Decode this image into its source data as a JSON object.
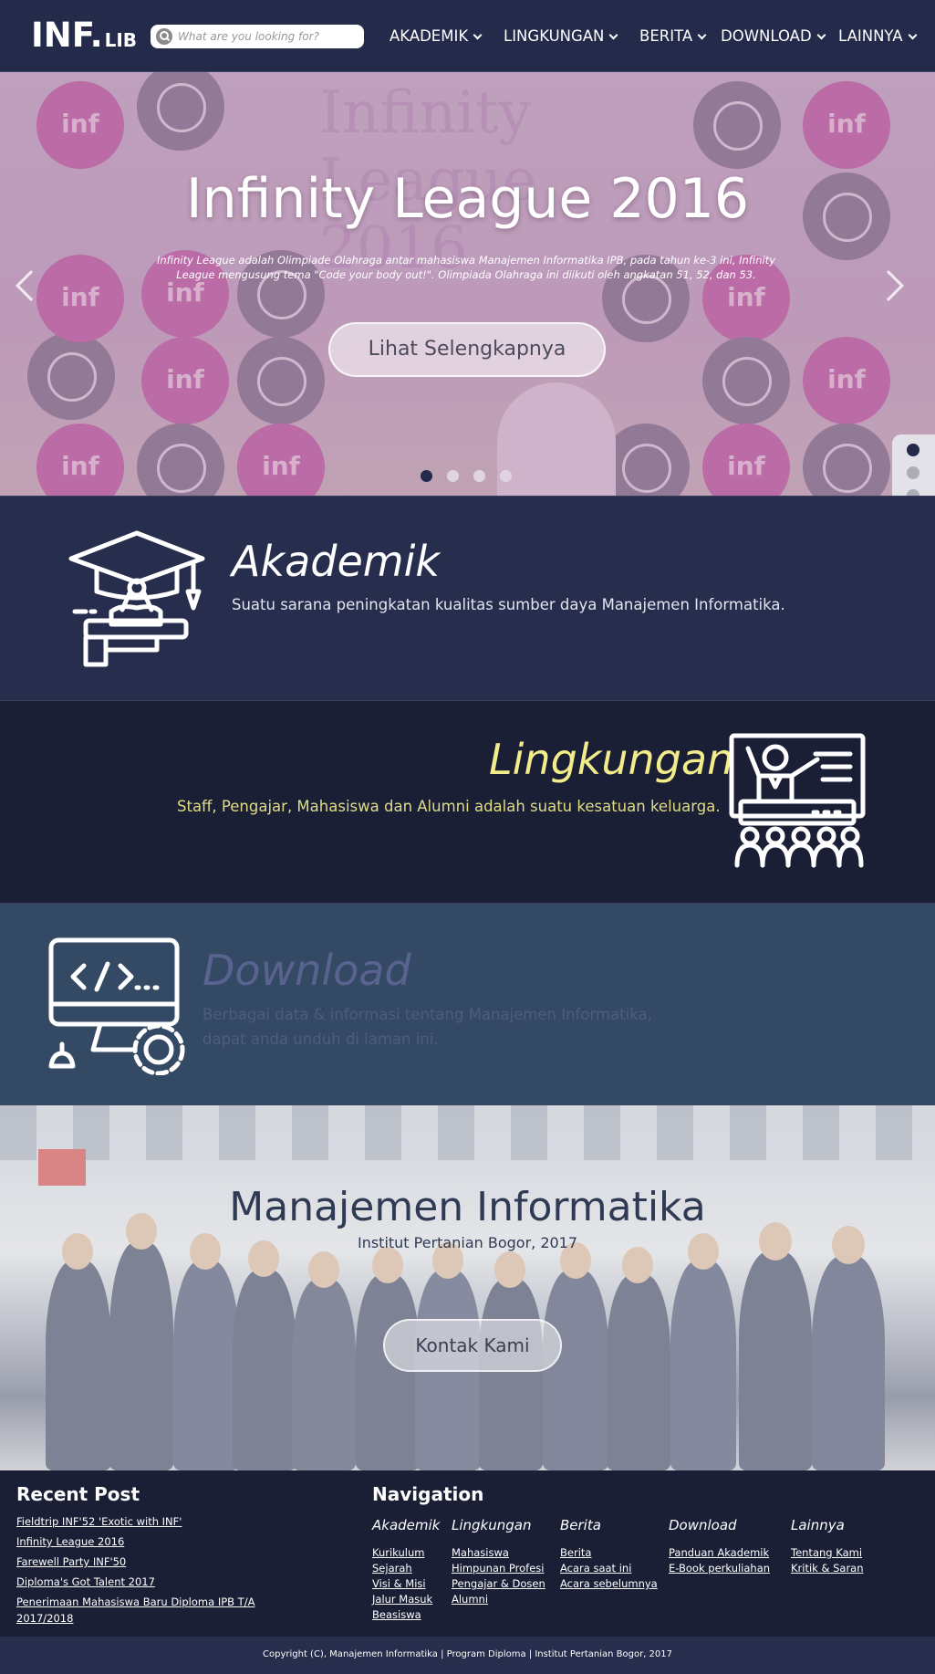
{
  "navbar": {
    "logo_main": "INF.",
    "logo_suffix": "LIB",
    "search_placeholder": "What are you looking for?",
    "menu": [
      "AKADEMIK",
      "LINGKUNGAN",
      "BERITA",
      "DOWNLOAD",
      "LAINNYA"
    ]
  },
  "hero": {
    "banner_title": "Infinity League 2016",
    "title": "Infinity League 2016",
    "description": "Infinity League adalah Olimpiade Olahraga antar mahasiswa Manajemen Informatika IPB, pada tahun ke-3 ini, Infinity League mengusung tema \"Code your body out!\". Olimpiada Olahraga ini diikuti oleh angkatan 51, 52, dan 53.",
    "button": "Lihat Selengkapnya",
    "slide_count": 4,
    "active_slide": 1
  },
  "side_nav": {
    "count": 5,
    "active": 1
  },
  "sections": {
    "akademik": {
      "title": "Akademik",
      "description": "Suatu sarana peningkatan kualitas sumber daya Manajemen Informatika.",
      "icon": "graduation-cap-icon",
      "title_color": "#ffffff"
    },
    "lingkungan": {
      "title": "Lingkungan",
      "description": "Staff, Pengajar, Mahasiswa dan Alumni adalah suatu kesatuan keluarga.",
      "icon": "teacher-audience-icon",
      "title_color": "#f2ed8a"
    },
    "download": {
      "title": "Download",
      "description_line1": "Berbagai data & informasi tentang Manajemen Informatika,",
      "description_line2": "dapat anda unduh di laman ini.",
      "icon": "computer-code-icon",
      "title_color": "#5a6390"
    }
  },
  "photo_banner": {
    "title": "Manajemen Informatika",
    "subtitle": "Institut Pertanian Bogor, 2017",
    "button": "Kontak Kami"
  },
  "footer": {
    "recent_post_heading": "Recent Post",
    "recent_posts": [
      "Fieldtrip INF'52 'Exotic with INF'",
      "Infinity League 2016",
      "Farewell Party INF'50",
      "Diploma's Got Talent 2017",
      "Penerimaan Mahasiswa Baru Diploma IPB T/A",
      "2017/2018"
    ],
    "navigation_heading": "Navigation",
    "columns": [
      {
        "heading": "Akademik",
        "links": [
          "Kurikulum",
          "Sejarah",
          "Visi & Misi",
          "Jalur Masuk",
          "Beasiswa"
        ]
      },
      {
        "heading": "Lingkungan",
        "links": [
          "Mahasiswa",
          "Himpunan Profesi",
          "Pengajar & Dosen",
          "Alumni"
        ]
      },
      {
        "heading": "Berita",
        "links": [
          "Berita",
          "Acara saat ini",
          "Acara sebelumnya"
        ]
      },
      {
        "heading": "Download",
        "links": [
          "Panduan Akademik",
          "E-Book perkuliahan"
        ]
      },
      {
        "heading": "Lainnya",
        "links": [
          "Tentang Kami",
          "Kritik & Saran"
        ]
      }
    ],
    "copyright": "Copyright (C), Manajemen Informatika | Program Diploma | Institut Pertanian Bogor, 2017"
  }
}
